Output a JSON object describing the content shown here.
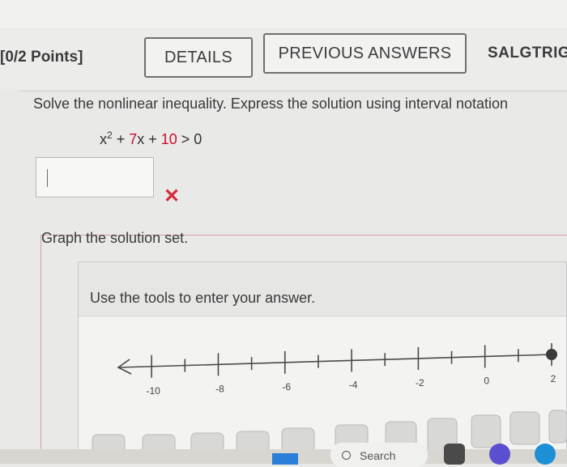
{
  "header": {
    "points_label": "[0/2 Points]",
    "details_label": "DETAILS",
    "previous_answers_label": "PREVIOUS ANSWERS",
    "source_label": "SALGTRIG"
  },
  "question": {
    "prompt": "Solve the nonlinear inequality. Express the solution using interval notation",
    "inequality_base": "x",
    "inequality_exp": "2",
    "inequality_mid": " + ",
    "inequality_coef": "7",
    "inequality_var": "x + ",
    "inequality_const": "10",
    "inequality_tail": " > 0",
    "answer_value": "",
    "status": "incorrect",
    "status_icon": "x-icon"
  },
  "graph": {
    "label": "Graph the solution set.",
    "tool_prompt": "Use the tools to enter your answer.",
    "number_line": {
      "min": -11,
      "max": 2,
      "tick_labels": [
        "-10",
        "-8",
        "-6",
        "-4",
        "-2",
        "0",
        "2"
      ],
      "tick_values": [
        -10,
        -8,
        -6,
        -4,
        -2,
        0,
        2
      ],
      "arrow_left": true,
      "filled_point": 2
    }
  },
  "taskbar": {
    "search_label": "Search"
  },
  "colors": {
    "red_accent": "#c8102e",
    "error": "#d42d3a",
    "windows_blue": "#2b7fd8"
  }
}
